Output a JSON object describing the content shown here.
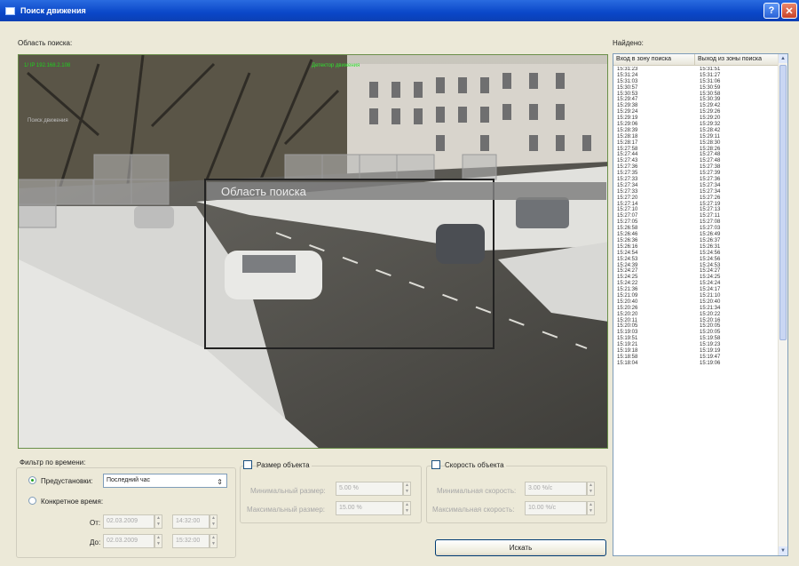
{
  "window": {
    "title": "Поиск движения"
  },
  "search_area": {
    "label": "Область поиска:",
    "region_label": "Область поиска",
    "overlay_top_left": "1/ IP 192.168.2.108",
    "overlay_top_right": "Детектор движения",
    "overlay_mid": "Поиск движения"
  },
  "found": {
    "label": "Найдено:",
    "columns": [
      "Вход в зону поиска",
      "Выход из зоны поиска"
    ],
    "rows": [
      [
        "15:31:23",
        "15:31:51"
      ],
      [
        "15:31:24",
        "15:31:27"
      ],
      [
        "15:31:03",
        "15:31:06"
      ],
      [
        "15:30:57",
        "15:30:59"
      ],
      [
        "15:30:53",
        "15:30:58"
      ],
      [
        "15:29:47",
        "15:30:39"
      ],
      [
        "15:29:38",
        "15:29:42"
      ],
      [
        "15:29:24",
        "15:29:26"
      ],
      [
        "15:29:19",
        "15:29:20"
      ],
      [
        "15:29:06",
        "15:29:32"
      ],
      [
        "15:28:39",
        "15:28:42"
      ],
      [
        "15:28:18",
        "15:29:11"
      ],
      [
        "15:28:17",
        "15:28:30"
      ],
      [
        "15:27:58",
        "15:28:26"
      ],
      [
        "15:27:44",
        "15:27:48"
      ],
      [
        "15:27:43",
        "15:27:48"
      ],
      [
        "15:27:36",
        "15:27:38"
      ],
      [
        "15:27:35",
        "15:27:39"
      ],
      [
        "15:27:33",
        "15:27:36"
      ],
      [
        "15:27:34",
        "15:27:34"
      ],
      [
        "15:27:33",
        "15:27:34"
      ],
      [
        "15:27:20",
        "15:27:26"
      ],
      [
        "15:27:14",
        "15:27:19"
      ],
      [
        "15:27:10",
        "15:27:13"
      ],
      [
        "15:27:07",
        "15:27:11"
      ],
      [
        "15:27:05",
        "15:27:08"
      ],
      [
        "15:26:58",
        "15:27:03"
      ],
      [
        "15:26:46",
        "15:26:49"
      ],
      [
        "15:26:36",
        "15:26:37"
      ],
      [
        "15:26:16",
        "15:26:31"
      ],
      [
        "15:24:54",
        "15:24:56"
      ],
      [
        "15:24:53",
        "15:24:56"
      ],
      [
        "15:24:39",
        "15:24:53"
      ],
      [
        "15:24:27",
        "15:24:27"
      ],
      [
        "15:24:25",
        "15:24:25"
      ],
      [
        "15:24:22",
        "15:24:24"
      ],
      [
        "15:21:36",
        "15:24:17"
      ],
      [
        "15:21:09",
        "15:21:10"
      ],
      [
        "15:20:40",
        "15:20:40"
      ],
      [
        "15:20:26",
        "15:21:34"
      ],
      [
        "15:20:20",
        "15:20:22"
      ],
      [
        "15:20:11",
        "15:20:16"
      ],
      [
        "15:20:05",
        "15:20:05"
      ],
      [
        "15:19:03",
        "15:20:05"
      ],
      [
        "15:19:51",
        "15:19:58"
      ],
      [
        "15:19:21",
        "15:19:23"
      ],
      [
        "15:19:18",
        "15:19:19"
      ],
      [
        "15:18:58",
        "15:19:47"
      ],
      [
        "15:18:04",
        "15:19:06"
      ]
    ]
  },
  "time_filter": {
    "label": "Фильтр по времени:",
    "preset_label": "Предустановки:",
    "preset_value": "Последний час",
    "exact_label": "Конкретное время:",
    "from_label": "От:",
    "to_label": "До:",
    "from_date": "02.03.2009",
    "from_time": "14:32:00",
    "to_date": "02.03.2009",
    "to_time": "15:32:00"
  },
  "object_size": {
    "label": "Размер объекта",
    "min_label": "Минимальный размер:",
    "min_value": "5.00 %",
    "max_label": "Максимальный размер:",
    "max_value": "15.00 %"
  },
  "object_speed": {
    "label": "Скорость объекта",
    "min_label": "Минимальная скорость:",
    "min_value": "3.00 %/с",
    "max_label": "Максимальная скорость:",
    "max_value": "10.00 %/с"
  },
  "search_button": "Искать",
  "colors": {
    "title_bar": "#0A47C8",
    "region_border": "#2b2b2b",
    "grid_cells": "#b8b8b8"
  }
}
